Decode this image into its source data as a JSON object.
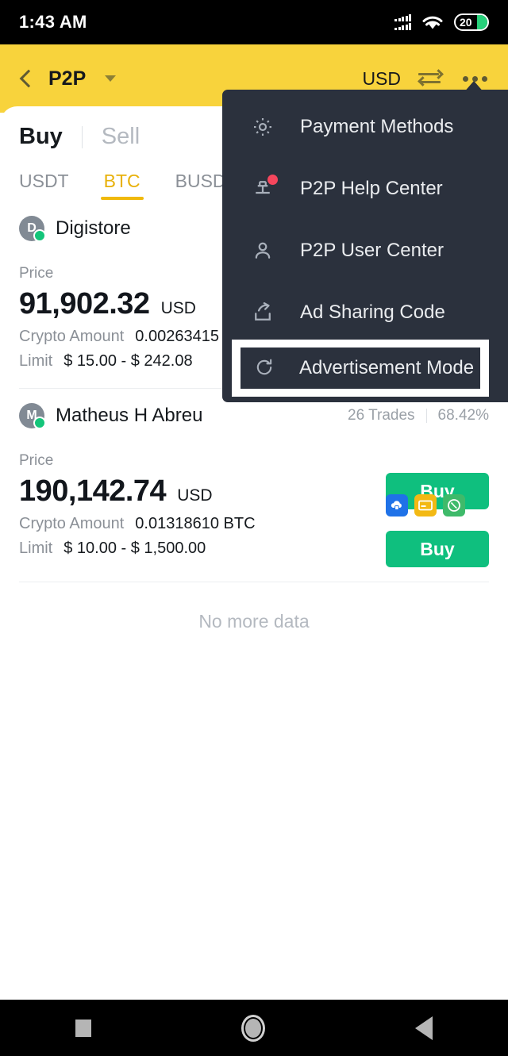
{
  "status_bar": {
    "time": "1:43 AM",
    "signal_icon": "signal-bars-icon",
    "wifi_icon": "wifi-icon",
    "battery_level": "20"
  },
  "header": {
    "back_icon": "back-chevron-icon",
    "title": "P2P",
    "title_caret_icon": "chevron-down-icon",
    "currency": "USD",
    "swap_icon": "swap-arrows-icon",
    "more_icon": "more-options-icon",
    "background_color": "#f8d33c"
  },
  "mode_tabs": {
    "buy_label": "Buy",
    "sell_label": "Sell",
    "active": "Buy"
  },
  "coin_tabs": {
    "items": [
      {
        "label": "USDT",
        "active": false
      },
      {
        "label": "BTC",
        "active": true
      },
      {
        "label": "BUSD",
        "active": false
      }
    ],
    "active_color": "#f0b90b"
  },
  "offers": [
    {
      "avatar_letter": "D",
      "merchant": "Digistore",
      "trades": "",
      "completion": "",
      "price_label": "Price",
      "price": "91,902.32",
      "currency": "USD",
      "crypto_amount_label": "Crypto Amount",
      "crypto_amount": "0.00263415 B",
      "limit_label": "Limit",
      "limit": "$ 15.00 - $ 242.08",
      "buy_label": "Buy",
      "payment_icons": []
    },
    {
      "avatar_letter": "M",
      "merchant": "Matheus H Abreu",
      "trades": "26 Trades",
      "completion": "68.42%",
      "price_label": "Price",
      "price": "190,142.74",
      "currency": "USD",
      "crypto_amount_label": "Crypto Amount",
      "crypto_amount": "0.01318610 BTC",
      "limit_label": "Limit",
      "limit": "$ 10.00 - $ 1,500.00",
      "buy_label": "Buy",
      "payment_icons": [
        "cloud-bank-icon",
        "credit-card-icon",
        "wallet-icon"
      ]
    }
  ],
  "footer_status": "No more data",
  "overflow_menu": {
    "items": [
      {
        "label": "Payment Methods",
        "icon": "gear-icon",
        "badge": false
      },
      {
        "label": "P2P Help Center",
        "icon": "support-desk-icon",
        "badge": true
      },
      {
        "label": "P2P User Center",
        "icon": "person-icon",
        "badge": false
      },
      {
        "label": "Ad Sharing Code",
        "icon": "share-export-icon",
        "badge": false
      }
    ],
    "highlighted_item": {
      "label": "Advertisement Mode",
      "icon": "refresh-icon"
    },
    "background_color": "#2b313d",
    "highlight_color": "#ffffff"
  },
  "nav_bar": {
    "recents_icon": "square-recents-icon",
    "home_icon": "circle-home-icon",
    "back_icon": "triangle-back-icon"
  }
}
